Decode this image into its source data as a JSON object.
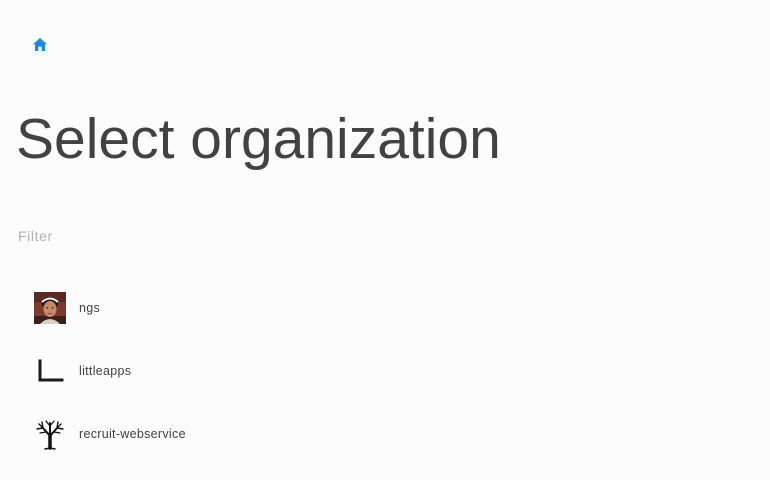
{
  "breadcrumb": {
    "home_icon": "home-icon",
    "home_color": "#1e88e5"
  },
  "page": {
    "title": "Select organization"
  },
  "filter": {
    "placeholder": "Filter",
    "value": ""
  },
  "organizations": [
    {
      "name": "ngs",
      "avatar": "person-photo-avatar"
    },
    {
      "name": "littleapps",
      "avatar": "corner-bracket-logo"
    },
    {
      "name": "recruit-webservice",
      "avatar": "tree-logo"
    }
  ]
}
